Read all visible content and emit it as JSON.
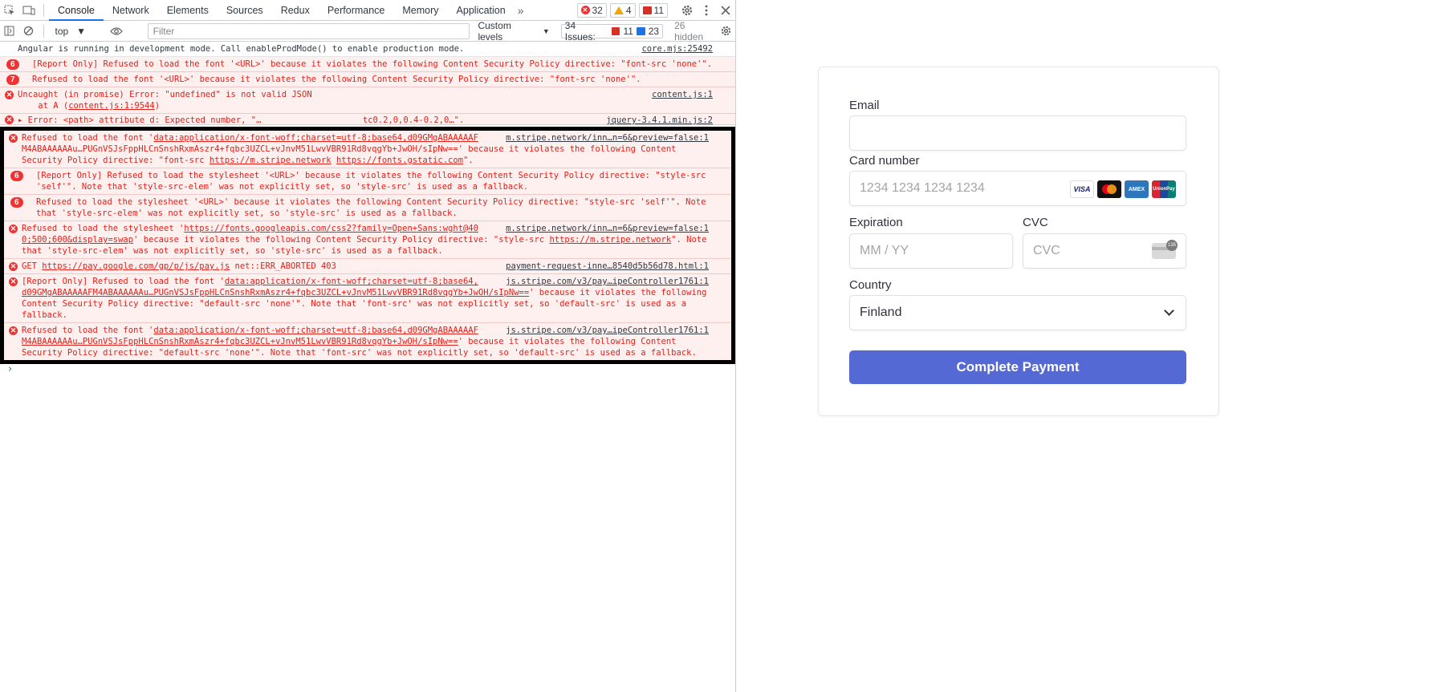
{
  "devtools": {
    "tabs": [
      "Console",
      "Network",
      "Elements",
      "Sources",
      "Redux",
      "Performance",
      "Memory",
      "Application"
    ],
    "tabs_more": "»",
    "counters": {
      "errors": "32",
      "warnings": "4",
      "issues": "11"
    },
    "context": "top",
    "filter_placeholder": "Filter",
    "levels": "Custom levels",
    "issues_label": "34 Issues:",
    "issues_errors": "11",
    "issues_info": "23",
    "hidden": "26 hidden"
  },
  "console": {
    "m0": {
      "text": "Angular is running in development mode. Call enableProdMode() to enable production mode.",
      "src": "core.mjs:25492"
    },
    "m1": {
      "badge": "6",
      "text": "[Report Only] Refused to load the font '<URL>' because it violates the following Content Security Policy directive: \"font-src 'none'\"."
    },
    "m2": {
      "badge": "7",
      "text": "Refused to load the font '<URL>' because it violates the following Content Security Policy directive: \"font-src 'none'\"."
    },
    "m3": {
      "text1": "Uncaught (in promise) Error: \"undefined\" is not valid JSON",
      "text2": "    at A (",
      "link": "content.js:1:9544",
      "text3": ")",
      "src": "content.js:1"
    },
    "m4": {
      "text": "▸ Error: <path> attribute d: Expected number, \"…                    tc0.2,0,0.4-0.2,0…\".",
      "src": "jquery-3.4.1.min.js:2"
    },
    "m5": {
      "pre": "Refused to load the font '",
      "url": "data:application/x-font-woff;charset=utf-8;base64,d09GMgABAAAAAF",
      "src": "m.stripe.network/inn…n=6&preview=false:1",
      "line2": "M4ABAAAAAAu…PUGnVSJsFppHLCnSnshRxmAszr4+fqbc3UZCL+vJnvM51LwvVBR91Rd8vqgYb+JwOH/sIpNw==' because it violates the following Content",
      "line3a": "Security Policy directive: \"font-src ",
      "l1": "https://m.stripe.network",
      "l2": "https://fonts.gstatic.com",
      "line3b": "\"."
    },
    "m6": {
      "badge": "6",
      "text": "[Report Only] Refused to load the stylesheet '<URL>' because it violates the following Content Security Policy directive: \"style-src 'self'\". Note that 'style-src-elem' was not explicitly set, so 'style-src' is used as a fallback."
    },
    "m7": {
      "badge": "6",
      "text": "Refused to load the stylesheet '<URL>' because it violates the following Content Security Policy directive: \"style-src 'self'\". Note that 'style-src-elem' was not explicitly set, so 'style-src' is used as a fallback."
    },
    "m8": {
      "pre": "Refused to load the stylesheet '",
      "url": "https://fonts.googleapis.com/css2?family=Open+Sans:wght@40",
      "src": "m.stripe.network/inn…n=6&preview=false:1",
      "url2": "0;500;600&display=swap",
      "mid": "' because it violates the following Content Security Policy directive: \"style-src ",
      "l1": "https://m.stripe.network",
      "tail": "\". Note that 'style-src-elem' was not explicitly set, so 'style-src' is used as a fallback."
    },
    "m9": {
      "pre": "GET ",
      "url": "https://pay.google.com/gp/p/js/pay.js",
      "post": " net::ERR_ABORTED 403",
      "src": "payment-request-inne…8540d5b56d78.html:1"
    },
    "m10": {
      "pre": "[Report Only] Refused to load the font '",
      "url": "data:application/x-font-woff;charset=utf-8;base64,",
      "src": "js.stripe.com/v3/pay…ipeController1761:1",
      "url2": "d09GMgABAAAAAFM4ABAAAAAAu…PUGnVSJsFppHLCnSnshRxmAszr4+fqbc3UZCL+vJnvM51LwvVBR91Rd8vqgYb+JwOH/sIpNw==",
      "tail": "' because it violates the following Content Security Policy directive: \"default-src 'none'\". Note that 'font-src' was not explicitly set, so 'default-src' is used as a fallback."
    },
    "m11": {
      "pre": "Refused to load the font '",
      "url": "data:application/x-font-woff;charset=utf-8;base64,d09GMgABAAAAAF",
      "src": "js.stripe.com/v3/pay…ipeController1761:1",
      "url2": "M4ABAAAAAAu…PUGnVSJsFppHLCnSnshRxmAszr4+fqbc3UZCL+vJnvM51LwvVBR91Rd8vqgYb+JwOH/sIpNw==",
      "tail": "' because it violates the following Content Security Policy directive: \"default-src 'none'\". Note that 'font-src' was not explicitly set, so 'default-src' is used as a fallback."
    }
  },
  "form": {
    "email_label": "Email",
    "card_label": "Card number",
    "card_placeholder": "1234 1234 1234 1234",
    "card_brands": [
      "VISA",
      "MC",
      "AMEX",
      "UnionPay"
    ],
    "exp_label": "Expiration",
    "exp_placeholder": "MM / YY",
    "cvc_label": "CVC",
    "cvc_placeholder": "CVC",
    "cvc_badge": "135",
    "country_label": "Country",
    "country_value": "Finland",
    "submit": "Complete Payment"
  }
}
